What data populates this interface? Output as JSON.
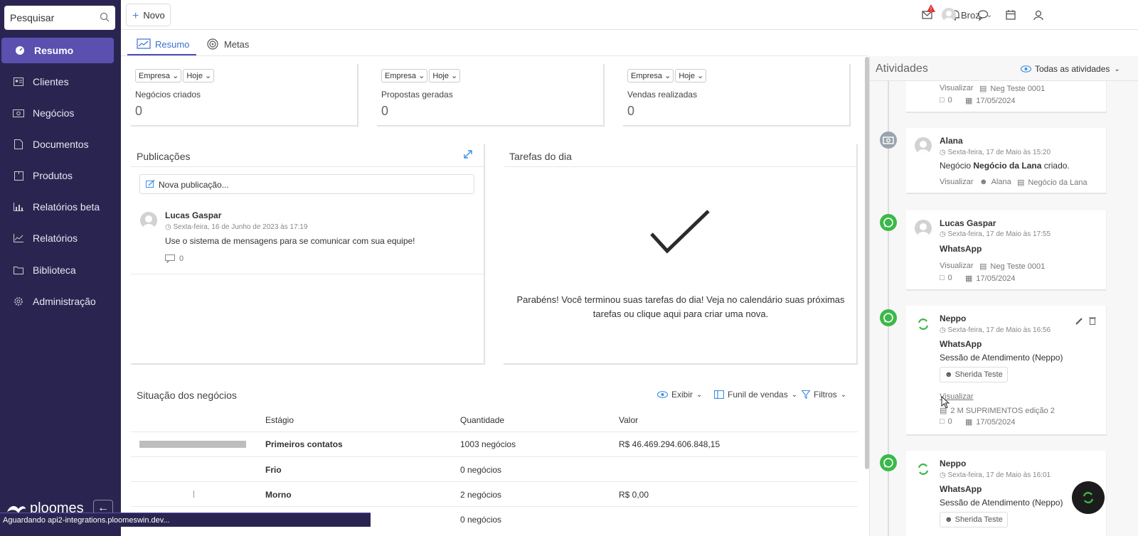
{
  "sidebar": {
    "search_placeholder": "Pesquisar",
    "items": [
      {
        "label": "Resumo",
        "icon": "dashboard-icon",
        "active": true
      },
      {
        "label": "Clientes",
        "icon": "contacts-icon"
      },
      {
        "label": "Negócios",
        "icon": "money-icon"
      },
      {
        "label": "Documentos",
        "icon": "document-icon"
      },
      {
        "label": "Produtos",
        "icon": "box-icon"
      },
      {
        "label": "Relatórios beta",
        "icon": "bar-chart-icon"
      },
      {
        "label": "Relatórios",
        "icon": "line-chart-icon"
      },
      {
        "label": "Biblioteca",
        "icon": "folder-icon"
      },
      {
        "label": "Administração",
        "icon": "gear-icon"
      }
    ],
    "brand": "ploomes",
    "collapse_label": "←"
  },
  "status_bar": "Aguardando api2-integrations.ploomeswin.dev...",
  "topbar": {
    "new_label": "Novo",
    "user_name": "Broz"
  },
  "tabs": [
    {
      "label": "Resumo"
    },
    {
      "label": "Metas"
    }
  ],
  "metrics": [
    {
      "filter1": "Empresa",
      "filter2": "Hoje",
      "label": "Negócios criados",
      "value": "0"
    },
    {
      "filter1": "Empresa",
      "filter2": "Hoje",
      "label": "Propostas geradas",
      "value": "0"
    },
    {
      "filter1": "Empresa",
      "filter2": "Hoje",
      "label": "Vendas realizadas",
      "value": "0"
    }
  ],
  "publications": {
    "title": "Publicações",
    "input_placeholder": "Nova publicação...",
    "post": {
      "author": "Lucas Gaspar",
      "date": "Sexta-feira, 16 de Junho de 2023 às 17:19",
      "text": "Use o sistema de mensagens para se comunicar com sua equipe!",
      "comments": "0"
    }
  },
  "tasks": {
    "title": "Tarefas do dia",
    "message": "Parabéns! Você terminou suas tarefas do dia! Veja no calendário suas próximas tarefas ou clique aqui para criar uma nova."
  },
  "deals": {
    "title": "Situação dos negócios",
    "tools": {
      "show": "Exibir",
      "funnel": "Funil de vendas",
      "filters": "Filtros"
    },
    "columns": [
      "Estágio",
      "Quantidade",
      "Valor"
    ],
    "rows": [
      {
        "stage": "Primeiros contatos",
        "qty": "1003 negócios",
        "value": "R$ 46.469.294.606.848,15",
        "fill": 1.0
      },
      {
        "stage": "Frio",
        "qty": "0 negócios",
        "value": "",
        "fill": 0
      },
      {
        "stage": "Morno",
        "qty": "2 negócios",
        "value": "R$ 0,00",
        "fill": 0.002
      },
      {
        "stage": "",
        "qty": "0 negócios",
        "value": "",
        "fill": 0
      }
    ]
  },
  "activities": {
    "title": "Atividades",
    "filter": "Todas as atividades",
    "items": [
      {
        "view": "Visualizar",
        "deal": "Neg Teste 0001",
        "comments": "0",
        "date": "17/05/2024"
      },
      {
        "name": "Alana",
        "date": "Sexta-feira, 17 de Maio às 15:20",
        "text_pre": "Negócio ",
        "text_bold": "Negócio da Lana",
        "text_post": " criado.",
        "view": "Visualizar",
        "person": "Alana",
        "deal": "Negócio da Lana"
      },
      {
        "name": "Lucas Gaspar",
        "date": "Sexta-feira, 17 de Maio às 17:55",
        "channel": "WhatsApp",
        "view": "Visualizar",
        "deal": "Neg Teste 0001",
        "comments": "0",
        "due": "17/05/2024"
      },
      {
        "name": "Neppo",
        "date": "Sexta-feira, 17 de Maio às 16:56",
        "channel": "WhatsApp",
        "text": "Sessão de Atendimento (Neppo)",
        "person": "Sherida Teste",
        "view": "Visualizar",
        "deal": "2 M SUPRIMENTOS edição 2",
        "comments": "0",
        "due": "17/05/2024"
      },
      {
        "name": "Neppo",
        "date": "Sexta-feira, 17 de Maio às 16:01",
        "channel": "WhatsApp",
        "text": "Sessão de Atendimento (Neppo)",
        "person": "Sherida Teste"
      }
    ]
  },
  "colors": {
    "sidebar": "#2a2550",
    "active": "#5b4fb0",
    "accent": "#3d6fd1",
    "whatsapp": "#3cb84a"
  }
}
